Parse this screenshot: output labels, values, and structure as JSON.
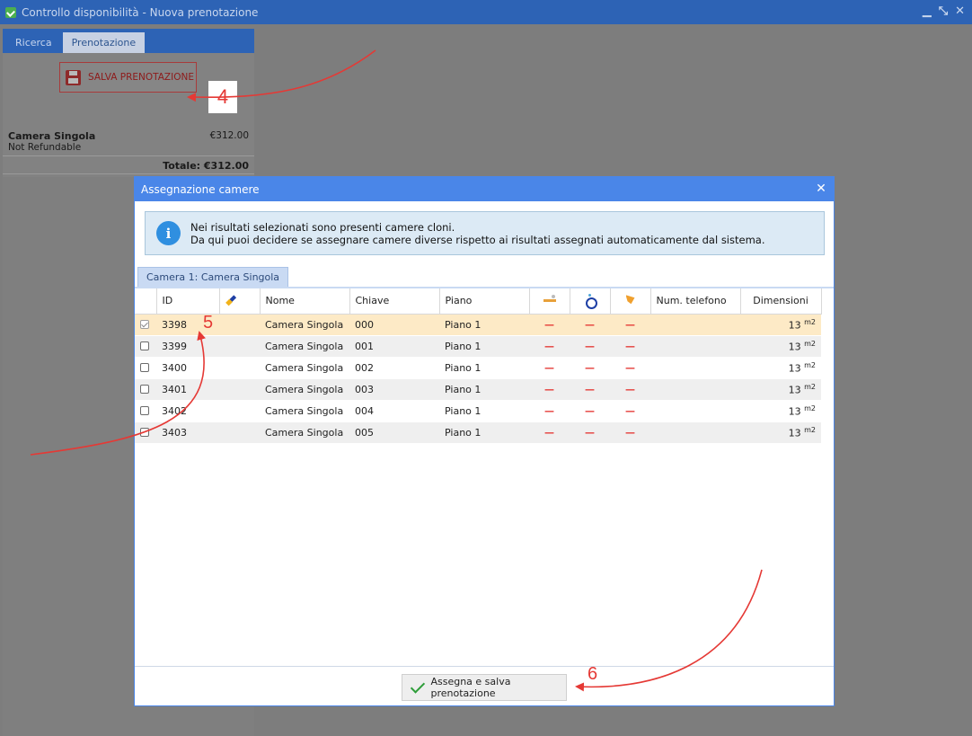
{
  "window": {
    "title": "Controllo disponibilità - Nuova prenotazione",
    "controls": [
      "▁",
      "⤡",
      "✕"
    ]
  },
  "left_panel": {
    "tabs": [
      {
        "label": "Ricerca",
        "active": false
      },
      {
        "label": "Prenotazione",
        "active": true
      }
    ],
    "save_button_label": "SALVA PRENOTAZIONE",
    "booking": {
      "room_name": "Camera Singola",
      "rate": "Not Refundable",
      "price": "€312.00"
    },
    "total": "Totale: €312.00"
  },
  "annotations": {
    "step4": "4",
    "step5": "5",
    "step6": "6"
  },
  "dialog": {
    "title": "Assegnazione camere",
    "close_icon": "close-icon",
    "info_line1": "Nei risultati selezionati sono presenti camere cloni.",
    "info_line2": "Da qui puoi decidere se assegnare camere diverse rispetto ai risultati assegnati automaticamente dal sistema.",
    "room_tab": "Camera 1: Camera Singola",
    "columns": {
      "id": "ID",
      "cleaning_icon": "cleaning-brush-icon",
      "name": "Nome",
      "key": "Chiave",
      "floor": "Piano",
      "smoking_icon": "smoking-icon",
      "accessible_icon": "wheelchair-icon",
      "pets_icon": "pet-icon",
      "phone": "Num. telefono",
      "size": "Dimensioni"
    },
    "rows": [
      {
        "checked": true,
        "id": "3398",
        "name": "Camera Singola",
        "key": "000",
        "floor": "Piano 1",
        "smoking": "—",
        "accessible": "—",
        "pets": "—",
        "phone": "",
        "size": "13",
        "unit": "m2"
      },
      {
        "checked": false,
        "id": "3399",
        "name": "Camera Singola",
        "key": "001",
        "floor": "Piano 1",
        "smoking": "—",
        "accessible": "—",
        "pets": "—",
        "phone": "",
        "size": "13",
        "unit": "m2"
      },
      {
        "checked": false,
        "id": "3400",
        "name": "Camera Singola",
        "key": "002",
        "floor": "Piano 1",
        "smoking": "—",
        "accessible": "—",
        "pets": "—",
        "phone": "",
        "size": "13",
        "unit": "m2"
      },
      {
        "checked": false,
        "id": "3401",
        "name": "Camera Singola",
        "key": "003",
        "floor": "Piano 1",
        "smoking": "—",
        "accessible": "—",
        "pets": "—",
        "phone": "",
        "size": "13",
        "unit": "m2"
      },
      {
        "checked": false,
        "id": "3402",
        "name": "Camera Singola",
        "key": "004",
        "floor": "Piano 1",
        "smoking": "—",
        "accessible": "—",
        "pets": "—",
        "phone": "",
        "size": "13",
        "unit": "m2"
      },
      {
        "checked": false,
        "id": "3403",
        "name": "Camera Singola",
        "key": "005",
        "floor": "Piano 1",
        "smoking": "—",
        "accessible": "—",
        "pets": "—",
        "phone": "",
        "size": "13",
        "unit": "m2"
      }
    ],
    "assign_button_label": "Assegna e salva prenotazione"
  },
  "colors": {
    "title_bar": "#2d63b5",
    "dialog_header": "#4a86e8",
    "selected_row": "#fdeac6",
    "annotation_red": "#e53935",
    "dash_red": "#e53935"
  }
}
